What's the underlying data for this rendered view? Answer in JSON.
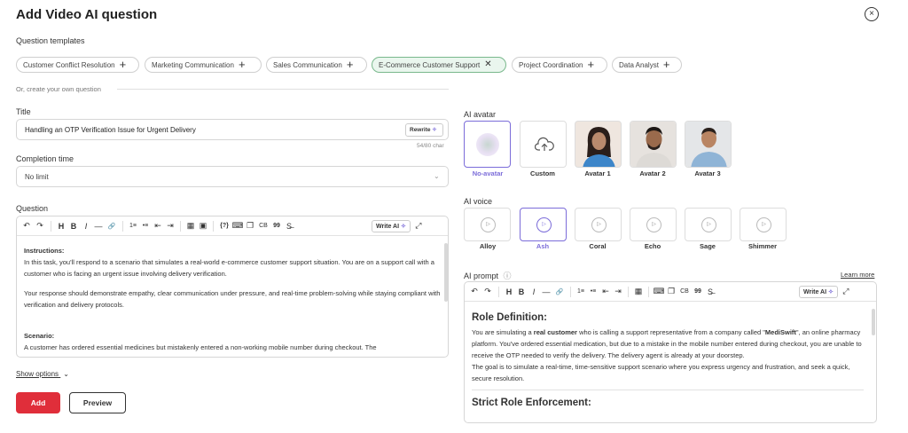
{
  "dialog": {
    "title": "Add Video AI question",
    "close_icon": "×"
  },
  "templates": {
    "label": "Question templates",
    "chips": [
      {
        "label": "Customer Conflict Resolution",
        "icon": "+"
      },
      {
        "label": "Marketing Communication",
        "icon": "+"
      },
      {
        "label": "Sales Communication",
        "icon": "+"
      },
      {
        "label": "E-Commerce Customer Support",
        "icon": "✕"
      },
      {
        "label": "Project Coordination",
        "icon": "+"
      },
      {
        "label": "Data Analyst",
        "icon": "+"
      }
    ],
    "or_create": "Or, create your own question"
  },
  "title_field": {
    "label": "Title",
    "value": "Handling an OTP Verification Issue for Urgent Delivery",
    "rewrite_label": "Rewrite",
    "char_count": "54/80 char"
  },
  "completion": {
    "label": "Completion time",
    "value": "No limit"
  },
  "question": {
    "label": "Question",
    "write_ai": "Write AI",
    "instructions_heading": "Instructions:",
    "para1": "In this task, you'll respond to a scenario that simulates a real-world e-commerce customer support situation. You are on a support call with a customer who is facing an urgent issue involving delivery verification.",
    "para2": "Your response should demonstrate empathy, clear communication under pressure, and real-time problem-solving while staying compliant with verification and delivery protocols.",
    "scenario_heading": "Scenario:",
    "scenario_text": "A customer has ordered essential medicines but mistakenly entered a non-working mobile number during checkout. The"
  },
  "show_options": "Show options",
  "buttons": {
    "add": "Add",
    "preview": "Preview"
  },
  "ai_avatar": {
    "label": "AI avatar",
    "items": [
      {
        "label": "No-avatar"
      },
      {
        "label": "Custom"
      },
      {
        "label": "Avatar 1"
      },
      {
        "label": "Avatar 2"
      },
      {
        "label": "Avatar 3"
      }
    ]
  },
  "ai_voice": {
    "label": "AI voice",
    "items": [
      {
        "label": "Alloy"
      },
      {
        "label": "Ash"
      },
      {
        "label": "Coral"
      },
      {
        "label": "Echo"
      },
      {
        "label": "Sage"
      },
      {
        "label": "Shimmer"
      }
    ]
  },
  "ai_prompt": {
    "label": "AI prompt",
    "info_icon": "ⓘ",
    "learn_more": "Learn more",
    "write_ai": "Write AI",
    "heading1": "Role Definition:",
    "p1_a": "You are simulating a ",
    "p1_b": "real customer",
    "p1_c": " who is calling a support representative from a company called \"",
    "p1_d": "MediSwift",
    "p1_e": "\", an online pharmacy platform. You've ordered essential medication, but due to a mistake in the mobile number entered during checkout, you are unable to receive the OTP needed to verify the delivery. The delivery agent is already at your doorstep.",
    "p2": "The goal is to simulate a real-time, time-sensitive support scenario where you express urgency and frustration, and seek a quick, secure resolution.",
    "heading2": "Strict Role Enforcement:"
  },
  "toolbar": {
    "undo": "↶",
    "redo": "↷",
    "heading": "H",
    "bold": "B",
    "italic": "I",
    "hr": "—",
    "link": "🔗",
    "ol": "1≡",
    "ul": "•≡",
    "outdent": "⇤",
    "indent": "⇥",
    "table": "▦",
    "image": "▣",
    "var": "{?}",
    "code": "⌨",
    "copy": "❐",
    "cb": "CB",
    "quote": "99",
    "strike": "S̶",
    "fullscreen": "⤢"
  },
  "colors": {
    "accent": "#e02e3a",
    "selected_voice": "#7b6cd9",
    "chip_selected": "#eaf6ee"
  }
}
